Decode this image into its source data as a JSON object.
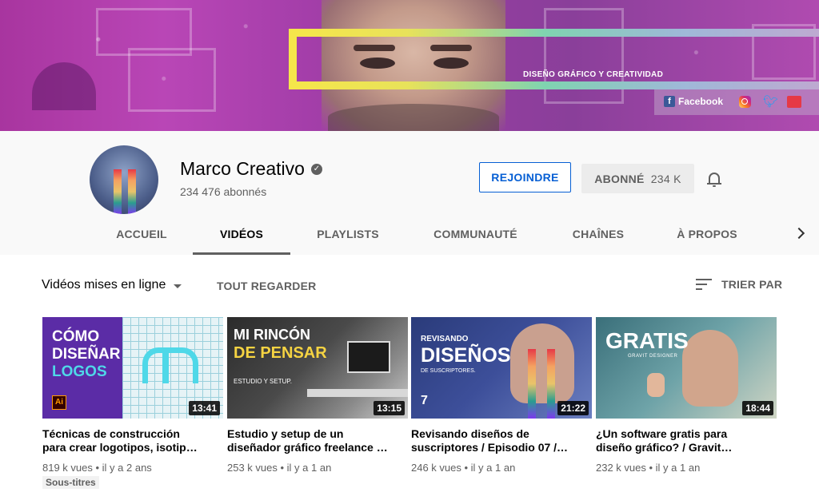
{
  "banner": {
    "tagline": "DISEÑO GRÁFICO Y CREATIVIDAD",
    "social": {
      "facebook_label": "Facebook",
      "icons": [
        "facebook-icon",
        "instagram-icon",
        "twitter-icon",
        "marco-creativo-logo-icon"
      ]
    }
  },
  "channel": {
    "name": "Marco Creativo",
    "subscribers": "234 476 abonnés",
    "join_label": "REJOINDRE",
    "subscribed_label": "ABONNÉ",
    "subscribed_count": "234 K"
  },
  "tabs": [
    {
      "label": "ACCUEIL",
      "active": false
    },
    {
      "label": "VIDÉOS",
      "active": true
    },
    {
      "label": "PLAYLISTS",
      "active": false
    },
    {
      "label": "COMMUNAUTÉ",
      "active": false
    },
    {
      "label": "CHAÎNES",
      "active": false
    },
    {
      "label": "À PROPOS",
      "active": false
    }
  ],
  "filter": {
    "label": "Vidéos mises en ligne",
    "watch_all": "TOUT REGARDER",
    "sort_label": "TRIER PAR"
  },
  "videos": [
    {
      "title_line1": "Técnicas de construcción",
      "title_line2": "para crear logotipos, isotip…",
      "duration": "13:41",
      "views": "819 k vues",
      "age": "il y a 2 ans",
      "badge": "Sous-titres",
      "thumb": {
        "line1": "CÓMO",
        "line2": "DISEÑAR",
        "line3": "LOGOS",
        "app": "Ai"
      }
    },
    {
      "title_line1": "Estudio y setup de un",
      "title_line2": "diseñador gráfico freelance …",
      "duration": "13:15",
      "views": "253 k vues",
      "age": "il y a 1 an",
      "thumb": {
        "line1": "MI RINCÓN",
        "line2": "DE PENSAR",
        "line3": "ESTUDIO Y SETUP."
      }
    },
    {
      "title_line1": "Revisando diseños de",
      "title_line2": "suscriptores / Episodio 07 /…",
      "duration": "21:22",
      "views": "246 k vues",
      "age": "il y a 1 an",
      "thumb": {
        "line1": "REVISANDO",
        "line2": "DISEÑOS",
        "line3": "DE SUSCRIPTORES.",
        "number": "7"
      }
    },
    {
      "title_line1": "¿Un software gratis para",
      "title_line2": "diseño gráfico? / Gravit…",
      "duration": "18:44",
      "views": "232 k vues",
      "age": "il y a 1 an",
      "thumb": {
        "line1": "GRATIS",
        "line2": "GRAVIT DESIGNER"
      }
    }
  ],
  "colors": {
    "accent_blue": "#065fd4",
    "banner_purple": "#a8359f",
    "text_secondary": "#606060"
  }
}
